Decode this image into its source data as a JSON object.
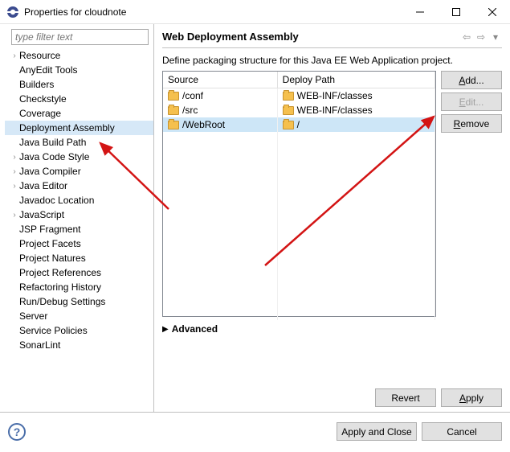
{
  "window": {
    "title": "Properties for cloudnote"
  },
  "filter": {
    "placeholder": "type filter text"
  },
  "tree": {
    "items": [
      {
        "label": "Resource",
        "expandable": true
      },
      {
        "label": "AnyEdit Tools"
      },
      {
        "label": "Builders"
      },
      {
        "label": "Checkstyle"
      },
      {
        "label": "Coverage"
      },
      {
        "label": "Deployment Assembly",
        "selected": true
      },
      {
        "label": "Java Build Path"
      },
      {
        "label": "Java Code Style",
        "expandable": true
      },
      {
        "label": "Java Compiler",
        "expandable": true
      },
      {
        "label": "Java Editor",
        "expandable": true
      },
      {
        "label": "Javadoc Location"
      },
      {
        "label": "JavaScript",
        "expandable": true
      },
      {
        "label": "JSP Fragment"
      },
      {
        "label": "Project Facets"
      },
      {
        "label": "Project Natures"
      },
      {
        "label": "Project References"
      },
      {
        "label": "Refactoring History"
      },
      {
        "label": "Run/Debug Settings"
      },
      {
        "label": "Server"
      },
      {
        "label": "Service Policies"
      },
      {
        "label": "SonarLint"
      }
    ]
  },
  "page": {
    "heading": "Web Deployment Assembly",
    "description": "Define packaging structure for this Java EE Web Application project.",
    "table": {
      "col_source": "Source",
      "col_deploy": "Deploy Path",
      "rows": [
        {
          "source": "/conf",
          "deploy": "WEB-INF/classes"
        },
        {
          "source": "/src",
          "deploy": "WEB-INF/classes"
        },
        {
          "source": "/WebRoot",
          "deploy": "/",
          "selected": true
        }
      ]
    },
    "buttons": {
      "add": "Add...",
      "edit": "Edit...",
      "remove": "Remove"
    },
    "advanced": "Advanced",
    "revert": "Revert",
    "apply": "Apply"
  },
  "footer": {
    "apply_close": "Apply and Close",
    "cancel": "Cancel"
  }
}
